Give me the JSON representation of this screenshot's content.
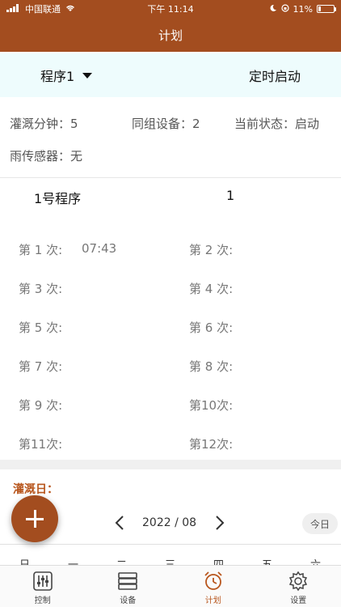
{
  "status": {
    "carrier": "中国联通",
    "time": "下午 11:14",
    "battery": "11%"
  },
  "nav": {
    "title": "计划"
  },
  "program_bar": {
    "selected_program": "程序1",
    "timer_start": "定时启动"
  },
  "info": {
    "irrigation_minutes_label": "灌溉分钟：5",
    "same_group_devices_label": "同组设备：2",
    "current_status_label": "当前状态：启动",
    "rain_sensor_label": "雨传感器：无"
  },
  "program": {
    "title": "1号程序",
    "number": "1"
  },
  "times": [
    {
      "label": "第 1 次:",
      "value": "07:43"
    },
    {
      "label": "第 2 次:",
      "value": ""
    },
    {
      "label": "第 3 次:",
      "value": ""
    },
    {
      "label": "第 4 次:",
      "value": ""
    },
    {
      "label": "第 5 次:",
      "value": ""
    },
    {
      "label": "第 6 次:",
      "value": ""
    },
    {
      "label": "第 7 次:",
      "value": ""
    },
    {
      "label": "第 8 次:",
      "value": ""
    },
    {
      "label": "第 9 次:",
      "value": ""
    },
    {
      "label": "第10次:",
      "value": ""
    },
    {
      "label": "第11次:",
      "value": ""
    },
    {
      "label": "第12次:",
      "value": ""
    }
  ],
  "calendar": {
    "section_label": "灌溉日：",
    "month": "2022 / 08",
    "today_button": "今日",
    "weekdays": [
      "日",
      "一",
      "二",
      "三",
      "四",
      "五",
      "六"
    ]
  },
  "tabs": [
    {
      "label": "控制",
      "icon": "control-panel-icon"
    },
    {
      "label": "设备",
      "icon": "device-list-icon"
    },
    {
      "label": "计划",
      "icon": "alarm-clock-icon"
    },
    {
      "label": "设置",
      "icon": "gear-icon"
    }
  ],
  "colors": {
    "accent": "#a34d1f",
    "program_bar_bg": "#eefcfd",
    "label_orange": "#b8561d"
  }
}
